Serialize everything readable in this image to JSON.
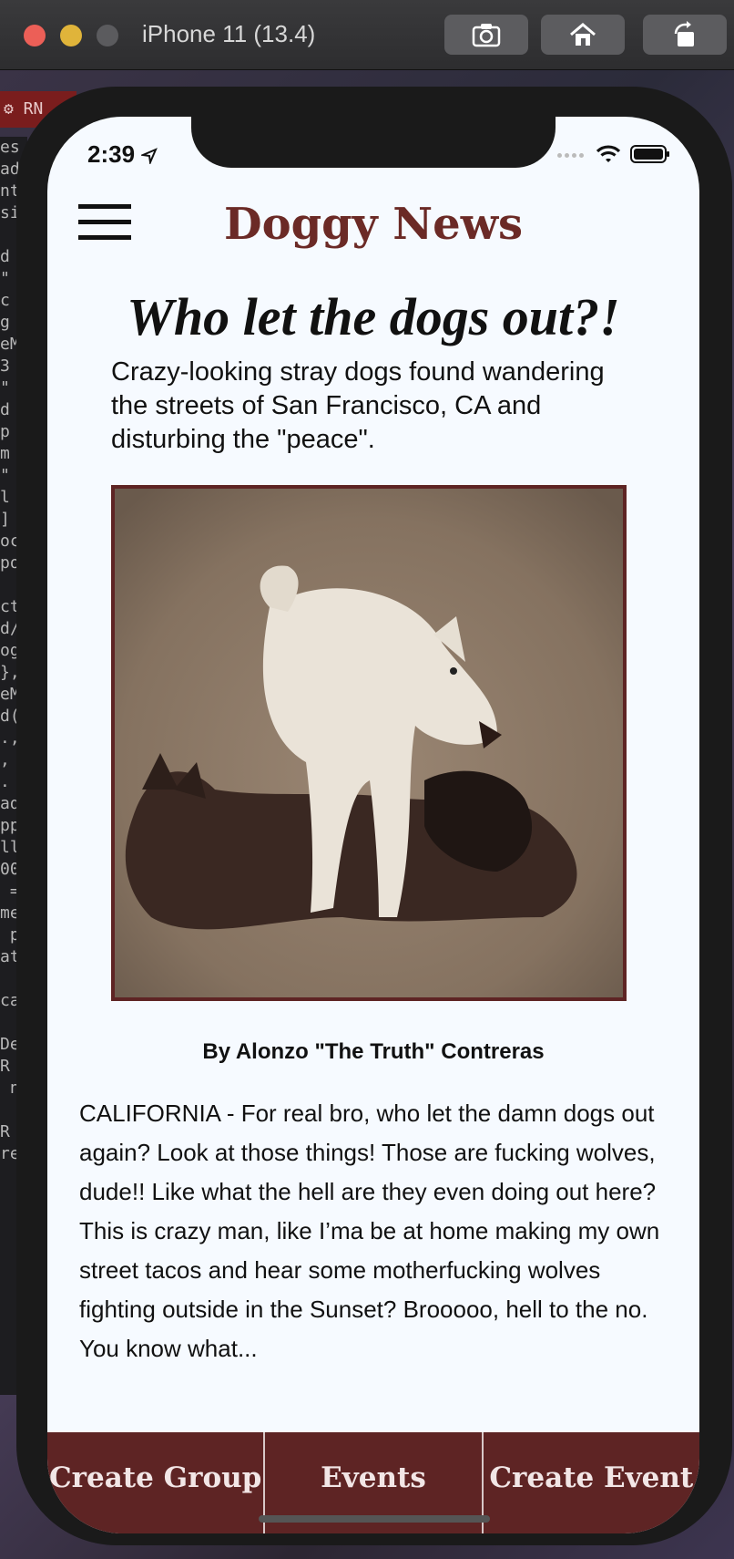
{
  "simulator": {
    "title": "iPhone 11 (13.4)",
    "side_tab": "⚙ RN",
    "code_lines": "es\nad\nnt\nsi\n\nd\n\"\nc\ng\neM\n3\n\"\nd\np\nm\n\"\nl\n]\noc\npo\n\nct\nd/\nog\n},\neM\nd(\n.,\n,\n.\nad\npp\nll\n00\n =\nme\n p\nat\n\nca\n\nDe\nR\n n\n\nR\nre"
  },
  "status_bar": {
    "time": "2:39"
  },
  "header": {
    "title": "Doggy News"
  },
  "article": {
    "headline": "Who let the dogs out?!",
    "subheadline": "Crazy-looking stray dogs found wandering the streets of San Francisco, CA and disturbing the \"peace\".",
    "byline": "By Alonzo \"The Truth\" Contreras",
    "body": "CALIFORNIA - For real bro, who let the damn dogs out again? Look at those things! Those are fucking wolves, dude!! Like what the hell are they even doing out here? This is crazy man, like I’ma be at home making my own street tacos and hear some motherfucking wolves fighting outside in the Sunset? Brooooo, hell to the no. You know what..."
  },
  "tabs": [
    {
      "label": "Create Group"
    },
    {
      "label": "Events"
    },
    {
      "label": "Create Event"
    }
  ],
  "colors": {
    "brand": "#5e2424",
    "title": "#6b2a26",
    "background": "#f6faff"
  }
}
